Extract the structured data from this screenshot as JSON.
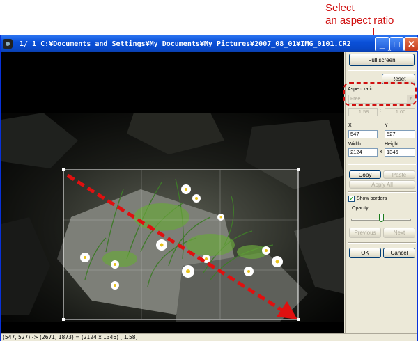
{
  "callout": {
    "line1": "Select",
    "line2": "an aspect ratio",
    "color": "#d01010"
  },
  "window": {
    "title": "1/  1  C:¥Documents and Settings¥My Documents¥My Pictures¥2007_08_01¥IMG_0101.CR2",
    "min_glyph": "_",
    "max_glyph": "□",
    "close_glyph": "✕"
  },
  "panel": {
    "full_screen": "Full screen",
    "reset": "Reset",
    "aspect_label": "Aspect ratio",
    "aspect_value": "Free",
    "ratio_w": "1.58",
    "ratio_sep": ":",
    "ratio_h": "1.00",
    "x_label": "X",
    "x_value": "547",
    "y_label": "Y",
    "y_value": "527",
    "width_label": "Width",
    "width_value": "2124",
    "times": "x",
    "height_label": "Height",
    "height_value": "1346",
    "copy": "Copy",
    "paste": "Paste",
    "apply_all": "Apply All",
    "show_borders": "Show borders",
    "show_borders_checked": true,
    "opacity_label": "Opacity",
    "opacity_level": 0.5,
    "previous": "Previous",
    "next": "Next",
    "ok": "OK",
    "cancel": "Cancel"
  },
  "status": {
    "text": "(547, 527) -> (2671, 1873) = (2124 x 1346) [ 1.58]"
  }
}
